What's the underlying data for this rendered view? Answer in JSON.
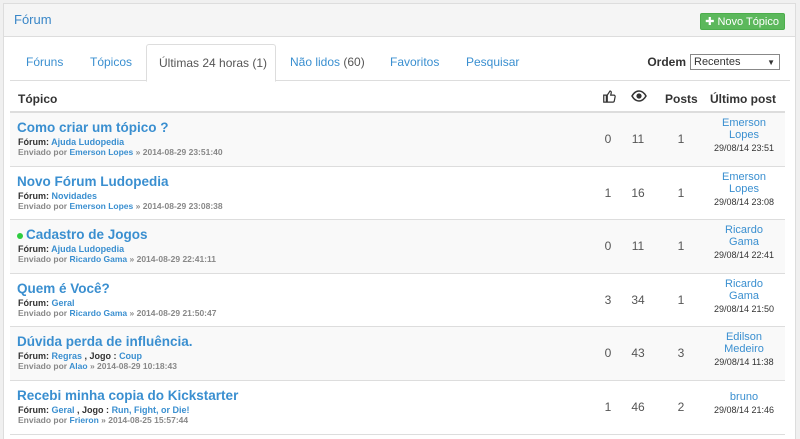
{
  "header": {
    "title": "Fórum",
    "new_topic_label": "Novo Tópico"
  },
  "tabs": [
    {
      "label": "Fóruns",
      "count": ""
    },
    {
      "label": "Tópicos",
      "count": ""
    },
    {
      "label": "Últimas 24 horas",
      "count": "(1)"
    },
    {
      "label": "Não lidos",
      "count": "(60)"
    },
    {
      "label": "Favoritos",
      "count": ""
    },
    {
      "label": "Pesquisar",
      "count": ""
    }
  ],
  "order": {
    "label": "Ordem",
    "selected": "Recentes"
  },
  "columns": {
    "topic": "Tópico",
    "posts": "Posts",
    "last_post": "Último post"
  },
  "topics": [
    {
      "title": "Como criar um tópico ?",
      "new": false,
      "forum_label": "Fórum:",
      "forum": "Ajuda Ludopedia",
      "game_label": "",
      "game": "",
      "sent_by_label": "Enviado por",
      "author": "Emerson Lopes",
      "sent_date": "» 2014-08-29 23:51:40",
      "likes": "0",
      "views": "11",
      "posts": "1",
      "last_author_1": "Emerson",
      "last_author_2": "Lopes",
      "last_date": "29/08/14 23:51"
    },
    {
      "title": "Novo Fórum Ludopedia",
      "new": false,
      "forum_label": "Fórum:",
      "forum": "Novidades",
      "game_label": "",
      "game": "",
      "sent_by_label": "Enviado por",
      "author": "Emerson Lopes",
      "sent_date": "» 2014-08-29 23:08:38",
      "likes": "1",
      "views": "16",
      "posts": "1",
      "last_author_1": "Emerson",
      "last_author_2": "Lopes",
      "last_date": "29/08/14 23:08"
    },
    {
      "title": "Cadastro de Jogos",
      "new": true,
      "forum_label": "Fórum:",
      "forum": "Ajuda Ludopedia",
      "game_label": "",
      "game": "",
      "sent_by_label": "Enviado por",
      "author": "Ricardo Gama",
      "sent_date": "» 2014-08-29 22:41:11",
      "likes": "0",
      "views": "11",
      "posts": "1",
      "last_author_1": "Ricardo",
      "last_author_2": "Gama",
      "last_date": "29/08/14 22:41"
    },
    {
      "title": "Quem é Você?",
      "new": false,
      "forum_label": "Fórum:",
      "forum": "Geral",
      "game_label": "",
      "game": "",
      "sent_by_label": "Enviado por",
      "author": "Ricardo Gama",
      "sent_date": "» 2014-08-29 21:50:47",
      "likes": "3",
      "views": "34",
      "posts": "1",
      "last_author_1": "Ricardo",
      "last_author_2": "Gama",
      "last_date": "29/08/14 21:50"
    },
    {
      "title": "Dúvida perda de influência.",
      "new": false,
      "forum_label": "Fórum:",
      "forum": "Regras",
      "game_label": ", Jogo :",
      "game": "Coup",
      "sent_by_label": "Enviado por",
      "author": "Alao",
      "sent_date": "» 2014-08-29 10:18:43",
      "likes": "0",
      "views": "43",
      "posts": "3",
      "last_author_1": "Edilson",
      "last_author_2": "Medeiro",
      "last_date": "29/08/14 11:38"
    },
    {
      "title": "Recebi minha copia do Kickstarter",
      "new": false,
      "forum_label": "Fórum:",
      "forum": "Geral",
      "game_label": ", Jogo :",
      "game": "Run, Fight, or Die!",
      "sent_by_label": "Enviado por",
      "author": "Frieron",
      "sent_date": "» 2014-08-25 15:57:44",
      "likes": "1",
      "views": "46",
      "posts": "2",
      "last_author_1": "bruno",
      "last_author_2": "",
      "last_date": "29/08/14 21:46"
    }
  ],
  "colors": {
    "link": "#3a8fd0",
    "button_green": "#5cb85c",
    "new_dot": "#2ecc40"
  },
  "icons": {
    "likes": "thumbs-up-icon",
    "views": "eye-icon",
    "new_topic": "plus-icon"
  }
}
